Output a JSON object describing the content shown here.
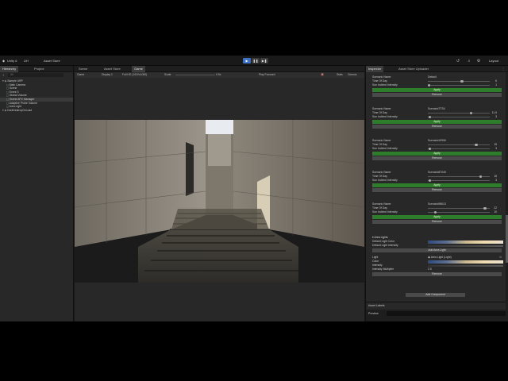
{
  "topbar": {
    "app_label": "Unity 6",
    "account_label": "UH",
    "asset_store_label": "Asset Store",
    "layout_label": "Layout"
  },
  "hierarchy": {
    "tabs": [
      "Hierarchy",
      "Project"
    ],
    "search_placeholder": "All",
    "items": [
      {
        "label": "Sample URP",
        "indent": 0
      },
      {
        "label": "Main Camera",
        "indent": 1
      },
      {
        "label": "Scene",
        "indent": 1
      },
      {
        "label": "Event S",
        "indent": 1
      },
      {
        "label": "Global Volume",
        "indent": 1
      },
      {
        "label": "Scene APV Manager",
        "indent": 1
      },
      {
        "label": "Adaptive Probe Volume",
        "indent": 1
      },
      {
        "label": "Area Light",
        "indent": 1
      },
      {
        "label": "DontDestroyOnLoad",
        "indent": 0
      }
    ]
  },
  "scene": {
    "tabs": [
      "Scene",
      "Asset Store",
      "Game"
    ],
    "active_tab": 2,
    "toolbar": {
      "game": "Game",
      "display": "Display 1",
      "resolution": "Full HD (1920x1080)",
      "scale_label": "Scale",
      "scale_value": "0.5x",
      "play_focused": "Play Focused",
      "stats": "Stats",
      "gizmos": "Gizmos"
    }
  },
  "inspector": {
    "tabs": [
      "Inspector",
      "Asset Store Uploader"
    ],
    "scenarios": [
      {
        "name": "Default",
        "time": "6",
        "indirect": "1",
        "time_frac": 0.55,
        "ind_frac": 0.02
      },
      {
        "name": "ScenarioTTS4",
        "time": "11.5",
        "indirect": "3",
        "time_frac": 0.7,
        "ind_frac": 0.03
      },
      {
        "name": "Scenario10906",
        "time": "15",
        "indirect": "3",
        "time_frac": 0.78,
        "ind_frac": 0.03
      },
      {
        "name": "Scenario87045",
        "time": "18",
        "indirect": "3",
        "time_frac": 0.85,
        "ind_frac": 0.03
      },
      {
        "name": "Scenario98613",
        "time": "22",
        "indirect": "10",
        "time_frac": 0.92,
        "ind_frac": 0.12
      }
    ],
    "labels": {
      "scenario_name": "Scenario Name",
      "time_of_day": "Time Of Day",
      "sun_indirect": "Sun Indirect Intensity",
      "apply": "Apply",
      "remove": "Remove"
    },
    "area_lights": {
      "header": "Area Lights",
      "default_color": "Default Light Color",
      "default_intensity": "Default Light Intensity",
      "add_button": "Add Area Light",
      "light_label": "Light",
      "light_value": "Area Light (Light)",
      "color_label": "Color",
      "intensity_label": "Intensity",
      "multiplier_label": "Intensity Multiplier",
      "multiplier_value": "2.5",
      "remove": "Remove"
    },
    "add_component": "Add Component",
    "asset_labels": "Asset Labels",
    "preview": "Preview"
  },
  "colors": {
    "apply": "#2e7d2a",
    "accent": "#3d6fc2"
  }
}
